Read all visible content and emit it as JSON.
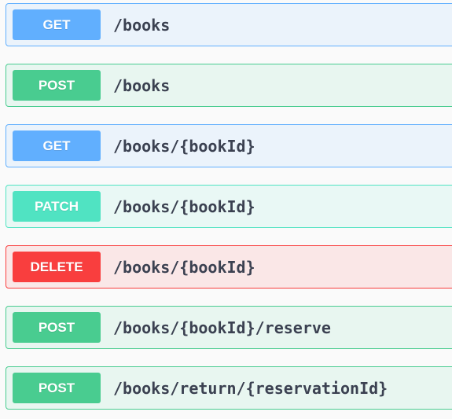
{
  "operations": [
    {
      "method": "GET",
      "path": "/books"
    },
    {
      "method": "POST",
      "path": "/books"
    },
    {
      "method": "GET",
      "path": "/books/{bookId}"
    },
    {
      "method": "PATCH",
      "path": "/books/{bookId}"
    },
    {
      "method": "DELETE",
      "path": "/books/{bookId}"
    },
    {
      "method": "POST",
      "path": "/books/{bookId}/reserve"
    },
    {
      "method": "POST",
      "path": "/books/return/{reservationId}"
    }
  ],
  "colors": {
    "get": "#61affe",
    "post": "#49cc90",
    "patch": "#50e3c2",
    "delete": "#f93e3e",
    "path_text": "#3b4151"
  }
}
